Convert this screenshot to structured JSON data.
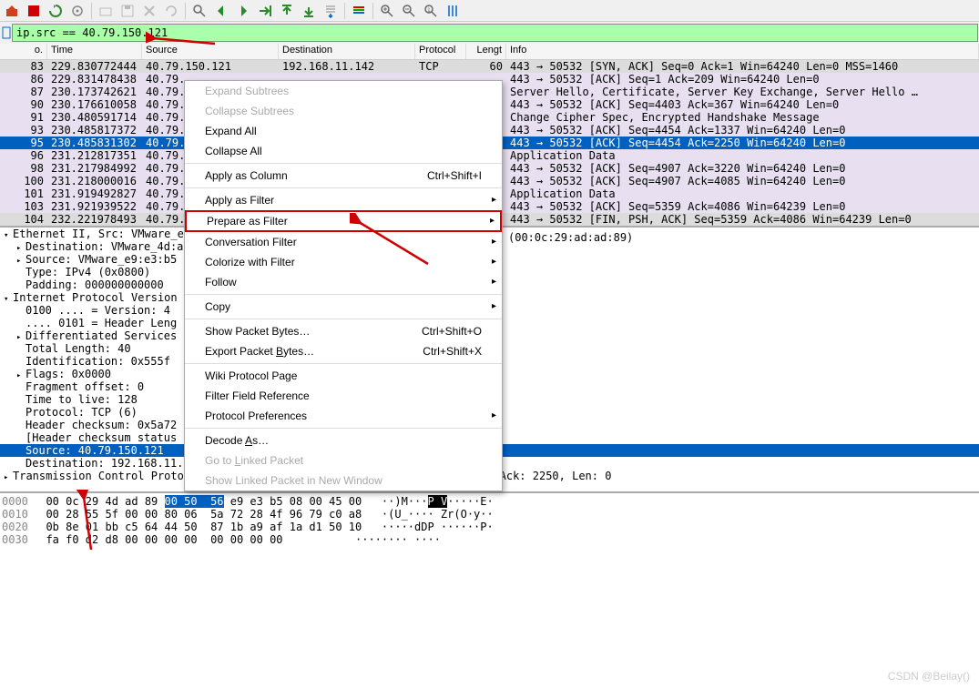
{
  "filter_text": "ip.src == 40.79.150.121",
  "columns": {
    "no": "o.",
    "time": "Time",
    "src": "Source",
    "dst": "Destination",
    "proto": "Protocol",
    "len": "Lengt",
    "info": "Info"
  },
  "rows": [
    {
      "no": "83",
      "time": "229.830772444",
      "src": "40.79.150.121",
      "dst": "192.168.11.142",
      "proto": "TCP",
      "len": "60",
      "info": "443 → 50532 [SYN, ACK] Seq=0 Ack=1 Win=64240 Len=0 MSS=1460",
      "cls": "gray"
    },
    {
      "no": "86",
      "time": "229.831478438",
      "src": "40.79.",
      "dst": "",
      "proto": "",
      "len": "",
      "info": "443 → 50532 [ACK] Seq=1 Ack=209 Win=64240 Len=0",
      "cls": "lav"
    },
    {
      "no": "87",
      "time": "230.173742621",
      "src": "40.79.",
      "dst": "",
      "proto": "",
      "len": "",
      "info": "Server Hello, Certificate, Server Key Exchange, Server Hello …",
      "cls": "lav"
    },
    {
      "no": "90",
      "time": "230.176610058",
      "src": "40.79.",
      "dst": "",
      "proto": "",
      "len": "",
      "info": "443 → 50532 [ACK] Seq=4403 Ack=367 Win=64240 Len=0",
      "cls": "lav"
    },
    {
      "no": "91",
      "time": "230.480591714",
      "src": "40.79.",
      "dst": "",
      "proto": "",
      "len": "",
      "info": "Change Cipher Spec, Encrypted Handshake Message",
      "cls": "lav"
    },
    {
      "no": "93",
      "time": "230.485817372",
      "src": "40.79.",
      "dst": "",
      "proto": "",
      "len": "",
      "info": "443 → 50532 [ACK] Seq=4454 Ack=1337 Win=64240 Len=0",
      "cls": "lav"
    },
    {
      "no": "95",
      "time": "230.485831302",
      "src": "40.79.",
      "dst": "",
      "proto": "",
      "len": "",
      "info": "443 → 50532 [ACK] Seq=4454 Ack=2250 Win=64240 Len=0",
      "cls": "sel"
    },
    {
      "no": "96",
      "time": "231.212817351",
      "src": "40.79.",
      "dst": "",
      "proto": "",
      "len": "",
      "info": "Application Data",
      "cls": "lav"
    },
    {
      "no": "98",
      "time": "231.217984992",
      "src": "40.79.",
      "dst": "",
      "proto": "",
      "len": "",
      "info": "443 → 50532 [ACK] Seq=4907 Ack=3220 Win=64240 Len=0",
      "cls": "lav"
    },
    {
      "no": "100",
      "time": "231.218000016",
      "src": "40.79.",
      "dst": "",
      "proto": "",
      "len": "",
      "info": "443 → 50532 [ACK] Seq=4907 Ack=4085 Win=64240 Len=0",
      "cls": "lav"
    },
    {
      "no": "101",
      "time": "231.919492827",
      "src": "40.79.",
      "dst": "",
      "proto": "",
      "len": "",
      "info": "Application Data",
      "cls": "lav"
    },
    {
      "no": "103",
      "time": "231.921939522",
      "src": "40.79.",
      "dst": "",
      "proto": "",
      "len": "",
      "info": "443 → 50532 [ACK] Seq=5359 Ack=4086 Win=64239 Len=0",
      "cls": "lav"
    },
    {
      "no": "104",
      "time": "232.221978493",
      "src": "40.79.",
      "dst": "",
      "proto": "",
      "len": "",
      "info": "443 → 50532 [FIN, PSH, ACK] Seq=5359 Ack=4086 Win=64239 Len=0",
      "cls": "gray"
    }
  ],
  "context_menu": [
    {
      "label": "Expand Subtrees",
      "disabled": true
    },
    {
      "label": "Collapse Subtrees",
      "disabled": true
    },
    {
      "label": "Expand All"
    },
    {
      "label": "Collapse All"
    },
    {
      "sep": true
    },
    {
      "label": "Apply as Column",
      "shortcut": "Ctrl+Shift+I"
    },
    {
      "sep": true
    },
    {
      "label": "Apply as Filter",
      "sub": true
    },
    {
      "label": "Prepare as Filter",
      "sub": true,
      "hl": true
    },
    {
      "label": "Conversation Filter",
      "sub": true
    },
    {
      "label": "Colorize with Filter",
      "sub": true
    },
    {
      "label": "Follow",
      "sub": true
    },
    {
      "sep": true
    },
    {
      "label": "Copy",
      "sub": true
    },
    {
      "sep": true
    },
    {
      "label": "Show Packet Bytes…",
      "shortcut": "Ctrl+Shift+O"
    },
    {
      "label": "Export Packet Bytes…",
      "shortcut": "Ctrl+Shift+X",
      "u": "B"
    },
    {
      "sep": true
    },
    {
      "label": "Wiki Protocol Page"
    },
    {
      "label": "Filter Field Reference"
    },
    {
      "label": "Protocol Preferences",
      "sub": true
    },
    {
      "sep": true
    },
    {
      "label": "Decode As…",
      "u": "A"
    },
    {
      "label": "Go to Linked Packet",
      "disabled": true,
      "u": "L"
    },
    {
      "label": "Show Linked Packet in New Window",
      "disabled": true
    }
  ],
  "details": {
    "right_text": "(00:0c:29:ad:ad:89)",
    "lines": [
      {
        "t": "Ethernet II, Src: VMware_e",
        "cls": "open",
        "ind": 0
      },
      {
        "t": "Destination: VMware_4d:a",
        "cls": "arrow",
        "ind": 1
      },
      {
        "t": "Source: VMware_e9:e3:b5",
        "cls": "arrow",
        "ind": 1
      },
      {
        "t": "Type: IPv4 (0x0800)",
        "cls": "noarw",
        "ind": 1
      },
      {
        "t": "Padding: 000000000000",
        "cls": "noarw",
        "ind": 1
      },
      {
        "t": "Internet Protocol Version",
        "cls": "open",
        "ind": 0
      },
      {
        "t": "0100 .... = Version: 4",
        "cls": "noarw",
        "ind": 1
      },
      {
        "t": ".... 0101 = Header Leng",
        "cls": "noarw",
        "ind": 1
      },
      {
        "t": "Differentiated Services",
        "cls": "arrow",
        "ind": 1
      },
      {
        "t": "Total Length: 40",
        "cls": "noarw",
        "ind": 1
      },
      {
        "t": "Identification: 0x555f",
        "cls": "noarw",
        "ind": 1
      },
      {
        "t": "Flags: 0x0000",
        "cls": "arrow",
        "ind": 1
      },
      {
        "t": "Fragment offset: 0",
        "cls": "noarw",
        "ind": 1
      },
      {
        "t": "Time to live: 128",
        "cls": "noarw",
        "ind": 1
      },
      {
        "t": "Protocol: TCP (6)",
        "cls": "noarw",
        "ind": 1
      },
      {
        "t": "Header checksum: 0x5a72",
        "cls": "noarw",
        "ind": 1
      },
      {
        "t": "[Header checksum status",
        "cls": "noarw",
        "ind": 1
      },
      {
        "t": "Source: 40.79.150.121",
        "cls": "noarw sel",
        "ind": 1
      },
      {
        "t": "Destination: 192.168.11.142",
        "cls": "noarw",
        "ind": 1
      },
      {
        "t": "Transmission Control Protocol, Src Port: 443, Dst Port: 50532, Seq: 4454, Ack: 2250, Len: 0",
        "cls": "arrow",
        "ind": 0
      }
    ]
  },
  "hex": {
    "rows": [
      {
        "off": "0000",
        "b": "00 0c 29 4d ad 89 ",
        "hl": "00 50  56",
        "b2": " e9 e3 b5 08 00 45 00",
        "a": "   ··)M···P V·····E·"
      },
      {
        "off": "0010",
        "b": "00 28 55 5f 00 00 80 06  5a 72 28 4f 96 79 c0 a8",
        "a": "   ·(U_···· Zr(O·y··"
      },
      {
        "off": "0020",
        "b": "0b 8e 01 bb c5 64 44 50  87 1b a9 af 1a d1 50 10",
        "a": "   ·····dDP ······P·"
      },
      {
        "off": "0030",
        "b": "fa f0 d2 d8 00 00 00 00  00 00 00 00",
        "a": "           ········ ····"
      }
    ]
  },
  "watermark": "CSDN @Beilay()"
}
